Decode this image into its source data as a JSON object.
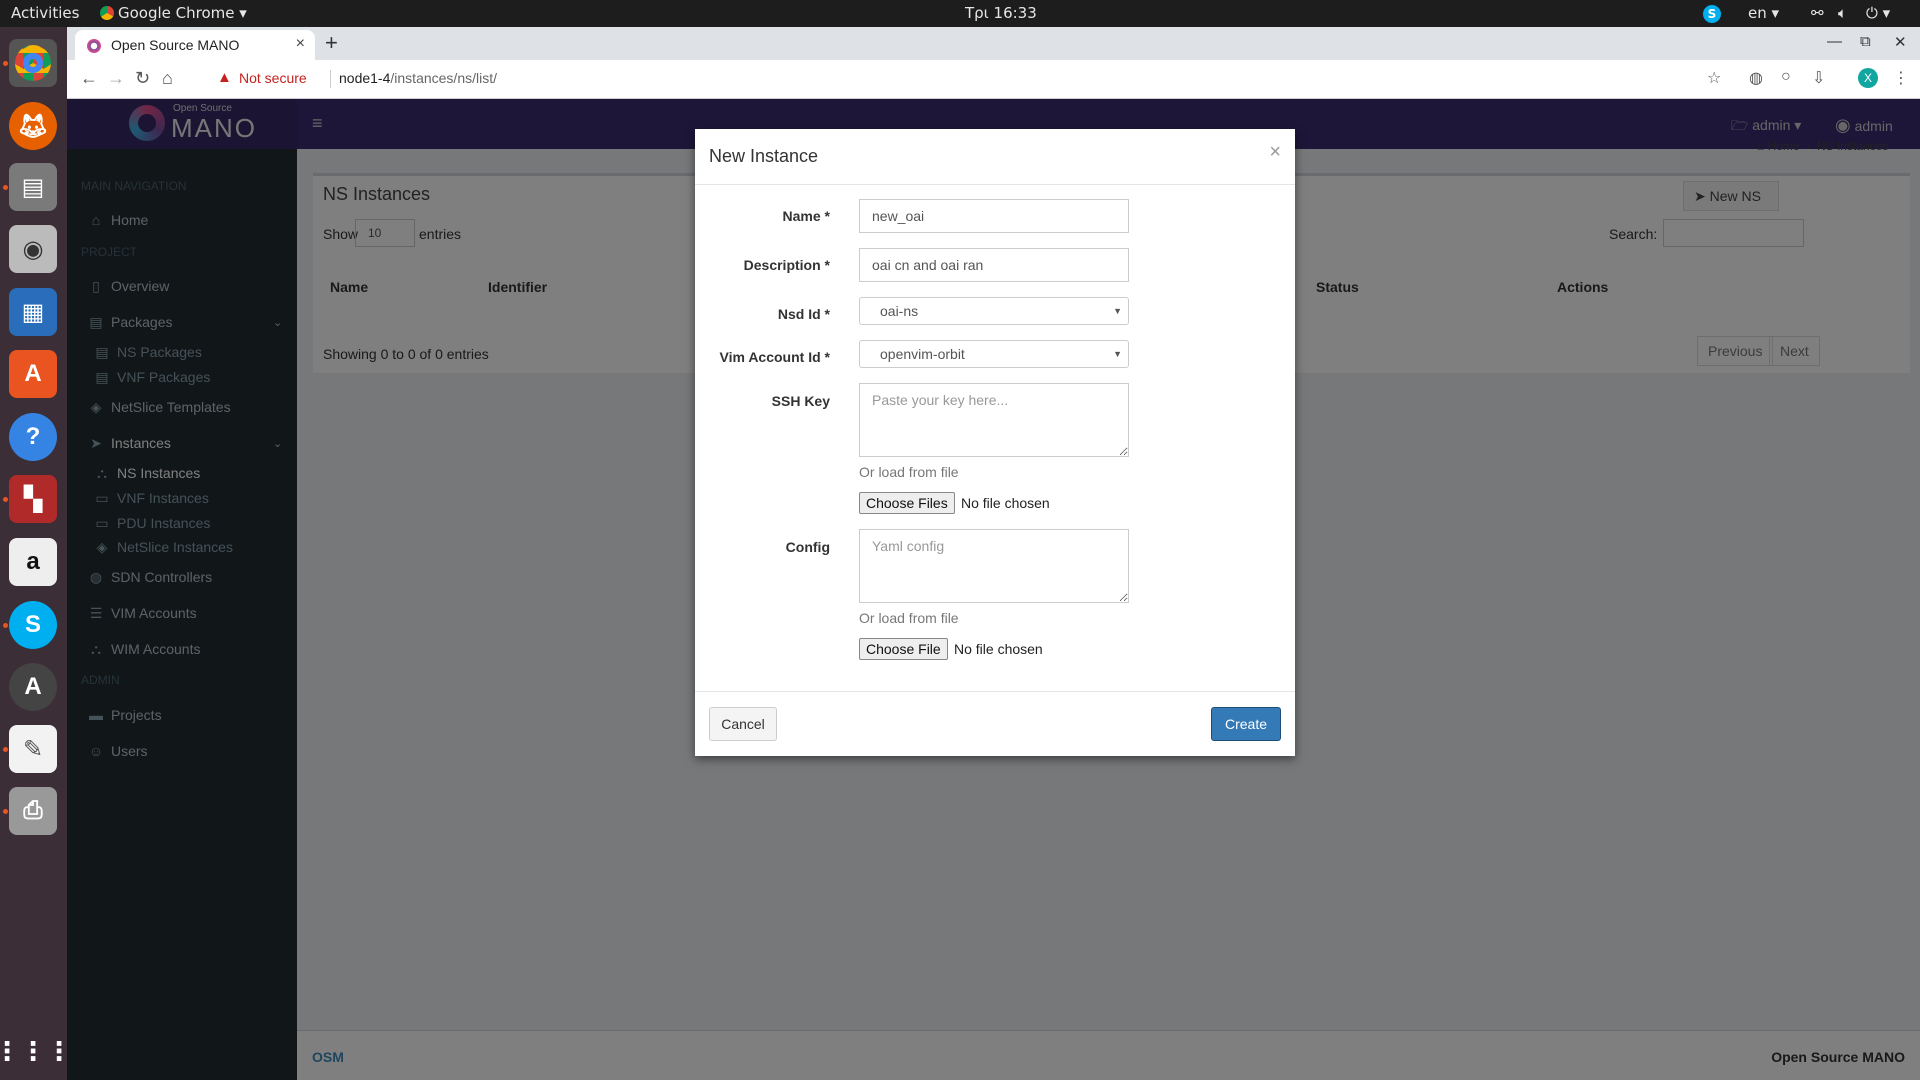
{
  "topbar": {
    "activities": "Activities",
    "app_name": "Google Chrome",
    "clock": "Τρι 16:33",
    "lang": "en"
  },
  "browser": {
    "tab_title": "Open Source MANO",
    "not_secure": "Not secure",
    "url_host": "node1-4",
    "url_path": "/instances/ns/list/",
    "profile_initial": "X"
  },
  "osm": {
    "logo_small": "Open Source",
    "logo_big": "MANO",
    "header_project": "admin",
    "header_user": "admin",
    "sidebar": {
      "main_nav": "MAIN NAVIGATION",
      "home": "Home",
      "project": "PROJECT",
      "overview": "Overview",
      "packages": "Packages",
      "ns_packages": "NS Packages",
      "vnf_packages": "VNF Packages",
      "netslice_templates": "NetSlice Templates",
      "instances": "Instances",
      "ns_instances": "NS Instances",
      "vnf_instances": "VNF Instances",
      "pdu_instances": "PDU Instances",
      "netslice_instances": "NetSlice Instances",
      "sdn_controllers": "SDN Controllers",
      "vim_accounts": "VIM Accounts",
      "wim_accounts": "WIM Accounts",
      "admin": "ADMIN",
      "projects": "Projects",
      "users": "Users"
    },
    "breadcrumb": {
      "home": "Home",
      "current": "NS Instances"
    },
    "content": {
      "title": "NS Instances",
      "new_ns": "New NS",
      "show": "Show",
      "entries_count": "10",
      "entries": "entries",
      "search": "Search:",
      "columns": [
        "Name",
        "Identifier",
        "Status",
        "Actions"
      ],
      "showing": "Showing 0 to 0 of 0 entries",
      "previous": "Previous",
      "next": "Next"
    },
    "footer_left": "OSM",
    "footer_right": "Open Source MANO"
  },
  "modal": {
    "title": "New Instance",
    "name_label": "Name *",
    "name_value": "new_oai",
    "description_label": "Description *",
    "description_value": "oai cn and oai ran",
    "nsd_label": "Nsd Id *",
    "nsd_value": "oai-ns",
    "vim_label": "Vim Account Id *",
    "vim_value": "openvim-orbit",
    "ssh_label": "SSH Key",
    "ssh_placeholder": "Paste your key here...",
    "or_load": "Or load from file",
    "choose_files": "Choose Files",
    "no_file": "No file chosen",
    "config_label": "Config",
    "config_placeholder": "Yaml config",
    "or_load_2": "Or load from file",
    "choose_file": "Choose File",
    "no_file_2": "No file chosen",
    "cancel": "Cancel",
    "create": "Create"
  }
}
